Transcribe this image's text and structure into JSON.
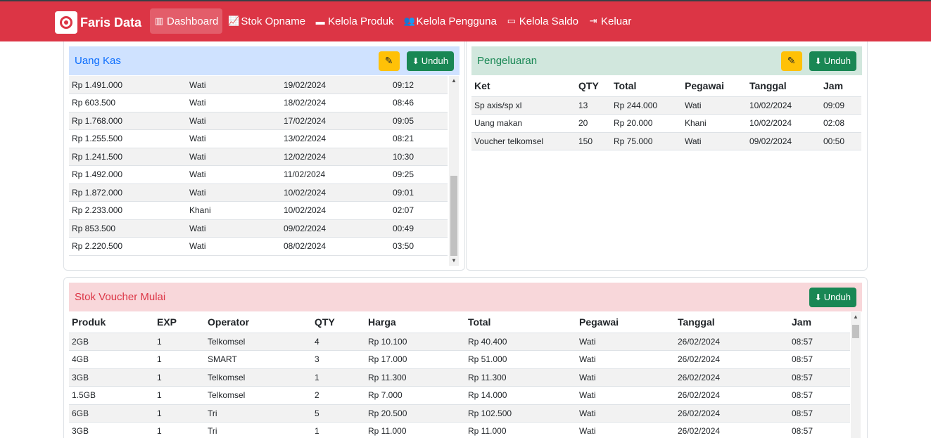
{
  "brand": {
    "name": "Faris Data",
    "logo_icon": "faris-logo"
  },
  "nav": [
    {
      "label": "Dashboard",
      "icon": "dashboard-icon",
      "glyph": "▥",
      "active": true
    },
    {
      "label": "Stok Opname",
      "icon": "chart-icon",
      "glyph": "📈",
      "active": false
    },
    {
      "label": "Kelola Produk",
      "icon": "box-icon",
      "glyph": "▬",
      "active": false
    },
    {
      "label": "Kelola Pengguna",
      "icon": "users-icon",
      "glyph": "👥",
      "active": false
    },
    {
      "label": "Kelola Saldo",
      "icon": "wallet-icon",
      "glyph": "▭",
      "active": false
    },
    {
      "label": "Keluar",
      "icon": "logout-icon",
      "glyph": "⇥",
      "active": false
    }
  ],
  "colors": {
    "navbar": "#dc3545",
    "uang_kas_header": "#cfe2ff",
    "pengeluaran_header": "#d1e7dd",
    "stok_header": "#f8d7da",
    "download": "#198754",
    "edit": "#ffc107"
  },
  "uang_kas": {
    "title": "Uang Kas",
    "download_label": "Unduh",
    "rows": [
      {
        "amount": "Rp 1.491.000",
        "name": "Wati",
        "date": "19/02/2024",
        "time": "09:12"
      },
      {
        "amount": "Rp 603.500",
        "name": "Wati",
        "date": "18/02/2024",
        "time": "08:46"
      },
      {
        "amount": "Rp 1.768.000",
        "name": "Wati",
        "date": "17/02/2024",
        "time": "09:05"
      },
      {
        "amount": "Rp 1.255.500",
        "name": "Wati",
        "date": "13/02/2024",
        "time": "08:21"
      },
      {
        "amount": "Rp 1.241.500",
        "name": "Wati",
        "date": "12/02/2024",
        "time": "10:30"
      },
      {
        "amount": "Rp 1.492.000",
        "name": "Wati",
        "date": "11/02/2024",
        "time": "09:25"
      },
      {
        "amount": "Rp 1.872.000",
        "name": "Wati",
        "date": "10/02/2024",
        "time": "09:01"
      },
      {
        "amount": "Rp 2.233.000",
        "name": "Khani",
        "date": "10/02/2024",
        "time": "02:07"
      },
      {
        "amount": "Rp 853.500",
        "name": "Wati",
        "date": "09/02/2024",
        "time": "00:49"
      },
      {
        "amount": "Rp 2.220.500",
        "name": "Wati",
        "date": "08/02/2024",
        "time": "03:50"
      }
    ]
  },
  "pengeluaran": {
    "title": "Pengeluaran",
    "download_label": "Unduh",
    "headers": [
      "Ket",
      "QTY",
      "Total",
      "Pegawai",
      "Tanggal",
      "Jam"
    ],
    "rows": [
      [
        "Sp axis/sp xl",
        "13",
        "Rp 244.000",
        "Wati",
        "10/02/2024",
        "09:09"
      ],
      [
        "Uang makan",
        "20",
        "Rp 20.000",
        "Khani",
        "10/02/2024",
        "02:08"
      ],
      [
        "Voucher telkomsel",
        "150",
        "Rp 75.000",
        "Wati",
        "09/02/2024",
        "00:50"
      ]
    ]
  },
  "stok_voucher": {
    "title": "Stok Voucher Mulai",
    "download_label": "Unduh",
    "headers": [
      "Produk",
      "EXP",
      "Operator",
      "QTY",
      "Harga",
      "Total",
      "Pegawai",
      "Tanggal",
      "Jam"
    ],
    "rows": [
      [
        "2GB",
        "1",
        "Telkomsel",
        "4",
        "Rp 10.100",
        "Rp 40.400",
        "Wati",
        "26/02/2024",
        "08:57"
      ],
      [
        "4GB",
        "1",
        "SMART",
        "3",
        "Rp 17.000",
        "Rp 51.000",
        "Wati",
        "26/02/2024",
        "08:57"
      ],
      [
        "3GB",
        "1",
        "Telkomsel",
        "1",
        "Rp 11.300",
        "Rp 11.300",
        "Wati",
        "26/02/2024",
        "08:57"
      ],
      [
        "1.5GB",
        "1",
        "Telkomsel",
        "2",
        "Rp 7.000",
        "Rp 14.000",
        "Wati",
        "26/02/2024",
        "08:57"
      ],
      [
        "6GB",
        "1",
        "Tri",
        "5",
        "Rp 20.500",
        "Rp 102.500",
        "Wati",
        "26/02/2024",
        "08:57"
      ],
      [
        "3GB",
        "1",
        "Tri",
        "1",
        "Rp 11.000",
        "Rp 11.000",
        "Wati",
        "26/02/2024",
        "08:57"
      ]
    ]
  }
}
